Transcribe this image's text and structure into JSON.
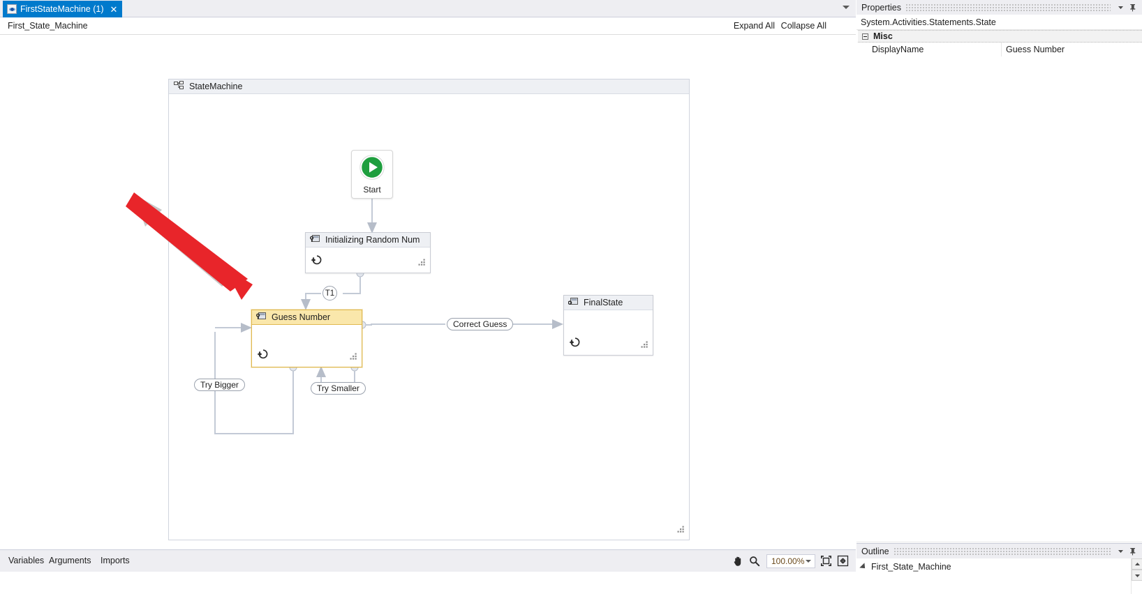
{
  "window": {
    "tab": {
      "label": "FirstStateMachine (1)",
      "close": "✕",
      "icon": "workflow-designer-icon"
    },
    "tab_overflow_icon": "chevron-down-icon"
  },
  "breadcrumb": {
    "path": "First_State_Machine",
    "expand_all": "Expand All",
    "collapse_all": "Collapse All"
  },
  "canvas": {
    "statemachine": {
      "title": "StateMachine",
      "icon": "state-machine-icon",
      "resize_grip_icon": "resize-grip-icon"
    },
    "start": {
      "label": "Start",
      "icon": "play-circle-icon"
    },
    "states": [
      {
        "title": "Initializing Random Num",
        "icon": "state-icon",
        "entry_icon": "entry-action-icon",
        "grip_icon": "resize-grip-icon",
        "selected": false
      },
      {
        "title": "Guess Number",
        "icon": "state-icon",
        "entry_icon": "entry-action-icon",
        "grip_icon": "resize-grip-icon",
        "selected": true
      },
      {
        "title": "FinalState",
        "icon": "final-state-icon",
        "entry_icon": "entry-action-icon",
        "grip_icon": "resize-grip-icon",
        "selected": false
      }
    ],
    "transitions": [
      {
        "label": "T1",
        "shape": "round"
      },
      {
        "label": "Correct Guess",
        "shape": "pill"
      },
      {
        "label": "Try Bigger",
        "shape": "pill"
      },
      {
        "label": "Try Smaller",
        "shape": "pill"
      }
    ],
    "selection_color": "#e0b951",
    "selection_header_color": "#fae7ab",
    "connector_color": "#c3cad6"
  },
  "bottom_bar": {
    "variables": "Variables",
    "arguments": "Arguments",
    "imports": "Imports",
    "pan_icon": "hand-pan-icon",
    "zoom_icon": "magnifier-icon",
    "zoom_level": "100.00%",
    "zoom_chevron_icon": "chevron-down-icon",
    "fit_to_screen_icon": "fit-to-screen-icon",
    "restore_zoom_icon": "restore-zoom-icon"
  },
  "properties_panel": {
    "title": "Properties",
    "object_type": "System.Activities.Statements.State",
    "menu_icon": "chevron-down-icon",
    "pin_icon": "pin-icon",
    "category": "Misc",
    "rows": [
      {
        "name": "DisplayName",
        "value": "Guess Number"
      }
    ]
  },
  "outline_panel": {
    "title": "Outline",
    "menu_icon": "chevron-down-icon",
    "pin_icon": "pin-icon",
    "root": "First_State_Machine",
    "scroll_up_icon": "scroll-up-icon",
    "scroll_down_icon": "scroll-down-icon"
  },
  "annotation": {
    "type": "red-arrow",
    "color": "#e8252a",
    "points_to": "Guess Number"
  }
}
